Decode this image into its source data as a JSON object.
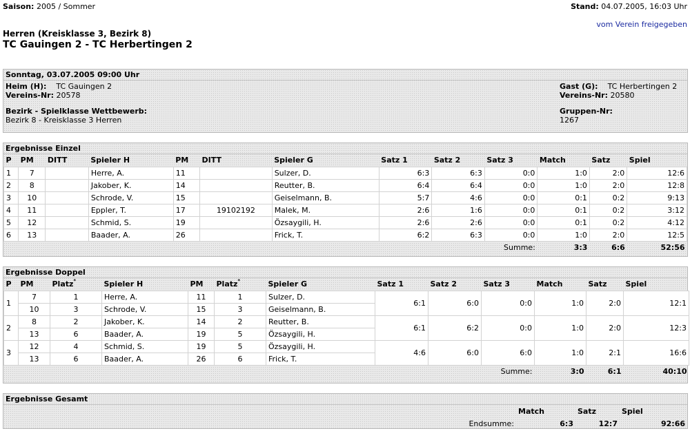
{
  "header": {
    "saison_label": "Saison:",
    "saison_value": "2005 / Sommer",
    "stand_label": "Stand:",
    "stand_value": "04.07.2005, 16:03 Uhr",
    "freigabe_link": "vom Verein freigegeben",
    "league": "Herren (Kreisklasse 3, Bezirk 8)",
    "match_title": "TC Gauingen 2 - TC Herbertingen 2"
  },
  "info": {
    "date_header": "Sonntag, 03.07.2005 09:00 Uhr",
    "heim_label": "Heim (H):",
    "heim_value": "TC Gauingen 2",
    "heim_vnr_label": "Vereins-Nr:",
    "heim_vnr_value": "20578",
    "gast_label": "Gast (G):",
    "gast_value": "TC Herbertingen 2",
    "gast_vnr_label": "Vereins-Nr:",
    "gast_vnr_value": "20580",
    "bezirk_label": "Bezirk - Spielklasse Wettbewerb:",
    "bezirk_value": "Bezirk 8 - Kreisklasse 3 Herren",
    "gruppe_label": "Gruppen-Nr:",
    "gruppe_value": "1267"
  },
  "einzel": {
    "title": "Ergebnisse Einzel",
    "headers": [
      "P",
      "PM",
      "DITT",
      "Spieler H",
      "PM",
      "DITT",
      "Spieler G",
      "Satz 1",
      "Satz 2",
      "Satz 3",
      "Match",
      "Satz",
      "Spiel"
    ],
    "rows": [
      [
        "1",
        "7",
        "",
        "Herre, A.",
        "11",
        "",
        "Sulzer, D.",
        "6:3",
        "6:3",
        "0:0",
        "1:0",
        "2:0",
        "12:6"
      ],
      [
        "2",
        "8",
        "",
        "Jakober, K.",
        "14",
        "",
        "Reutter, B.",
        "6:4",
        "6:4",
        "0:0",
        "1:0",
        "2:0",
        "12:8"
      ],
      [
        "3",
        "10",
        "",
        "Schrode, V.",
        "15",
        "",
        "Geiselmann, B.",
        "5:7",
        "4:6",
        "0:0",
        "0:1",
        "0:2",
        "9:13"
      ],
      [
        "4",
        "11",
        "",
        "Eppler, T.",
        "17",
        "19102192",
        "Malek, M.",
        "2:6",
        "1:6",
        "0:0",
        "0:1",
        "0:2",
        "3:12"
      ],
      [
        "5",
        "12",
        "",
        "Schmid, S.",
        "19",
        "",
        "Özsaygili, H.",
        "2:6",
        "2:6",
        "0:0",
        "0:1",
        "0:2",
        "4:12"
      ],
      [
        "6",
        "13",
        "",
        "Baader, A.",
        "26",
        "",
        "Frick, T.",
        "6:2",
        "6:3",
        "0:0",
        "1:0",
        "2:0",
        "12:5"
      ]
    ],
    "sum_label": "Summe:",
    "sum_match": "3:3",
    "sum_satz": "6:6",
    "sum_spiel": "52:56"
  },
  "doppel": {
    "title": "Ergebnisse Doppel",
    "headers": [
      "P",
      "PM",
      "Platz",
      "Spieler H",
      "PM",
      "Platz",
      "Spieler G",
      "Satz 1",
      "Satz 2",
      "Satz 3",
      "Match",
      "Satz",
      "Spiel"
    ],
    "platz_marker": "*",
    "pairs": [
      {
        "p": "1",
        "players": [
          {
            "pm_h": "7",
            "platz_h": "1",
            "name_h": "Herre, A.",
            "pm_g": "11",
            "platz_g": "1",
            "name_g": "Sulzer, D."
          },
          {
            "pm_h": "10",
            "platz_h": "3",
            "name_h": "Schrode, V.",
            "pm_g": "15",
            "platz_g": "3",
            "name_g": "Geiselmann, B."
          }
        ],
        "satz1": "6:1",
        "satz2": "6:0",
        "satz3": "0:0",
        "match": "1:0",
        "satz": "2:0",
        "spiel": "12:1"
      },
      {
        "p": "2",
        "players": [
          {
            "pm_h": "8",
            "platz_h": "2",
            "name_h": "Jakober, K.",
            "pm_g": "14",
            "platz_g": "2",
            "name_g": "Reutter, B."
          },
          {
            "pm_h": "13",
            "platz_h": "6",
            "name_h": "Baader, A.",
            "pm_g": "19",
            "platz_g": "5",
            "name_g": "Özsaygili, H."
          }
        ],
        "satz1": "6:1",
        "satz2": "6:2",
        "satz3": "0:0",
        "match": "1:0",
        "satz": "2:0",
        "spiel": "12:3"
      },
      {
        "p": "3",
        "players": [
          {
            "pm_h": "12",
            "platz_h": "4",
            "name_h": "Schmid, S.",
            "pm_g": "19",
            "platz_g": "5",
            "name_g": "Özsaygili, H."
          },
          {
            "pm_h": "13",
            "platz_h": "6",
            "name_h": "Baader, A.",
            "pm_g": "26",
            "platz_g": "6",
            "name_g": "Frick, T."
          }
        ],
        "satz1": "4:6",
        "satz2": "6:0",
        "satz3": "6:0",
        "match": "1:0",
        "satz": "2:1",
        "spiel": "16:6"
      }
    ],
    "sum_label": "Summe:",
    "sum_match": "3:0",
    "sum_satz": "6:1",
    "sum_spiel": "40:10"
  },
  "gesamt": {
    "title": "Ergebnisse Gesamt",
    "headers": [
      "Match",
      "Satz",
      "Spiel"
    ],
    "sum_label": "Endsumme:",
    "match": "6:3",
    "satz": "12:7",
    "spiel": "92:66"
  },
  "colors": {
    "link": "#1a2aa0",
    "box_border": "#b8b8b8",
    "hatch_bg": "#e9e9e9"
  }
}
